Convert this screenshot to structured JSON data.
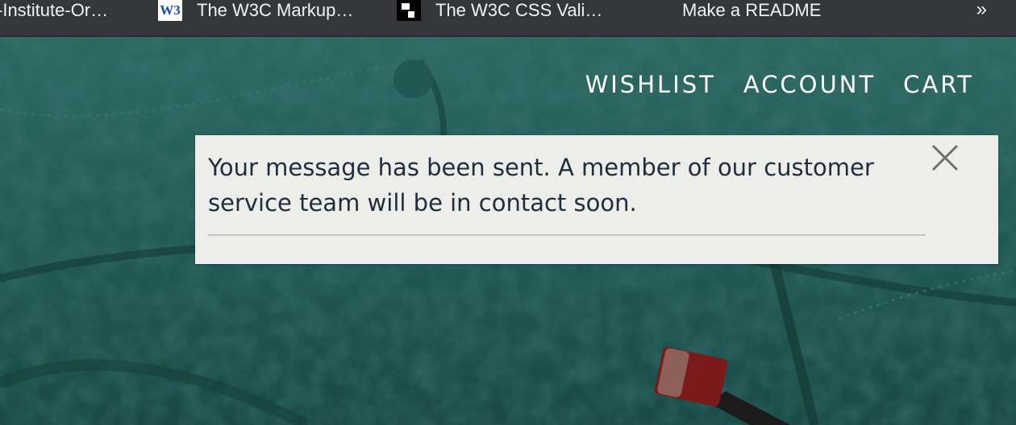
{
  "bookmarks": [
    {
      "label": "-Institute-Or…",
      "icon": "none"
    },
    {
      "label": "The W3C Markup…",
      "icon": "w3c-icon"
    },
    {
      "label": "The W3C CSS Vali…",
      "icon": "qr-favicon-icon"
    },
    {
      "label": "Make a README",
      "icon": "none"
    }
  ],
  "bookmarks_overflow": "»",
  "nav": {
    "wishlist": "WISHLIST",
    "account": "ACCOUNT",
    "cart": "CART"
  },
  "alert": {
    "message": "Your message has been sent. A member of our customer service team will be in contact soon."
  },
  "colors": {
    "bookmarks_bg": "#35363a",
    "hero_teal": "#1f5a55",
    "alert_bg": "#edede9",
    "alert_text": "#1f2d3d"
  }
}
